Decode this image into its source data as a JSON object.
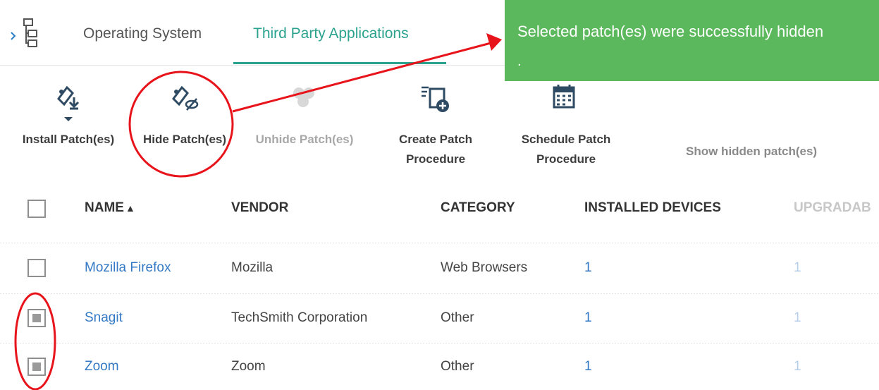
{
  "tabs": [
    {
      "label": "Operating System"
    },
    {
      "label": "Third Party Applications"
    }
  ],
  "toast": {
    "message": "Selected patch(es) were successfully hidden",
    "trailing": "."
  },
  "toolbar": {
    "install": {
      "line1": "Install Patch(es)",
      "icon": "install-patch-icon"
    },
    "hide": {
      "line1": "Hide Patch(es)",
      "icon": "hide-patch-icon"
    },
    "unhide": {
      "line1": "Unhide Patch(es)",
      "icon": "unhide-patch-icon"
    },
    "create": {
      "line1": "Create Patch",
      "line2": "Procedure",
      "icon": "create-procedure-icon"
    },
    "schedule": {
      "line1": "Schedule Patch",
      "line2": "Procedure",
      "icon": "calendar-icon"
    },
    "show_hidden": "Show hidden patch(es)"
  },
  "table": {
    "columns": [
      "NAME",
      "VENDOR",
      "CATEGORY",
      "INSTALLED DEVICES",
      "UPGRADAB"
    ],
    "sort_indicator": "▲",
    "rows": [
      {
        "name": "Mozilla Firefox",
        "vendor": "Mozilla",
        "category": "Web Browsers",
        "installed": "1",
        "upgradable": "1",
        "checked": false
      },
      {
        "name": "Snagit",
        "vendor": "TechSmith Corporation",
        "category": "Other",
        "installed": "1",
        "upgradable": "1",
        "checked": true
      },
      {
        "name": "Zoom",
        "vendor": "Zoom",
        "category": "Other",
        "installed": "1",
        "upgradable": "1",
        "checked": true
      }
    ]
  },
  "colors": {
    "accent": "#2aa28e",
    "toast_bg": "#5cb85c",
    "annotation": "#e8141b",
    "link": "#3479c4"
  }
}
